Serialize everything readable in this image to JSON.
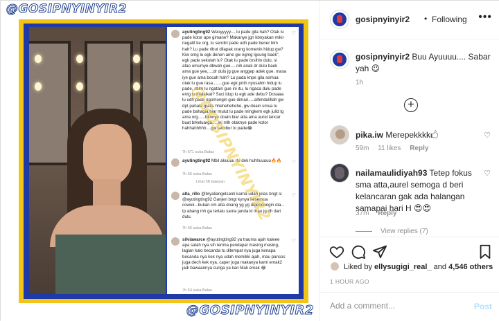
{
  "media": {
    "watermark": "@GOSIPNYINYIR2",
    "watermark_bottom": "@GOSIPNYINYIR2",
    "diagonal_watermark": "@GOSIPNYINYIR2",
    "screenshot_comments": [
      {
        "user": "ayutingting92",
        "text": "Weoyyyyy.....lu pade gila hah? Otak lu pade kotor ape gimane? Makanye jgn kbnyakan mikir negatif ke org, lu sendiri pade udh pade bener blm hah? Lu pade ribut dilapak orang komenin hidup gw? Kiw emg lu egk denen ame gw ngmg lgsung baek\", egk pade sekolah lu? Otak lu pade brsihin dulu, si atao umumye dbwah gue.....nih anak dr dulu baek ama gue yee,....dr dulu jg gue anggep adek gue, masa iye gue ama bocah hah? Lu pada knpe gila semua otak lu gue rasa........gue egk pnth nyusahin hidup lu pade, sblm lu ngatain gue ini itu, lu ngaca dulu pade emg lu malaikat? Suci idup lu egk ade debu? Dosaaa lu udh pade ngomongin gue dimari.....alhmdulillah gw dpt pahala gratis hhehehehehe, gw doain smua lu pade bahagia biar mulut lu pade mingkem egk julid lg ama org......bknnye doain biar atta ama aurel lancar buat brkeluarga,....ini mlh otaknye pade kotor hahhahhhhh....gw sembur lo pade😂",
        "meta": "7h   671 suka   Balas"
      },
      {
        "user": "ayutingting92",
        "text": "Mbil akuuuu itu dek huhhuuuuu🔥🔥",
        "meta": "7h   66 suka   Balas",
        "view": "Lihat 58 balasan"
      },
      {
        "user": "alta_rillo",
        "text": "@bryaliangelsanti karna udah jelas bngt si @ayutingting92 Ganjen bngt kynya kesemua cowok...bukan cm atta doang yg yg digendongin dia... tp abang mh ga terlalu sama janda kl mau jg dh dari dulu.",
        "meta": "7h   66 suka   Balas"
      },
      {
        "user": "silviawarce",
        "text": "@ayutingting92 ya trauma ajah kaleee apa salah nya sih terima pendapat masing masing, lagian kalo becanda tu ditempat nya juga kenapa becanda nya kek nya udah memiliki ajah, mau pansos juga dech kek nya, caper juga makanya kami emak2 jadi bawaannya curiga ya kan Mak emak 😂",
        "meta": "7h   53 suka   Balas"
      }
    ]
  },
  "header": {
    "username": "gosipnyinyir2",
    "separator": "•",
    "follow_status": "Following",
    "more_icon": "more-horizontal-icon"
  },
  "caption": {
    "username": "gosipnyinyir2",
    "text": "Buu Ayuuuu.... Sabar yah 😉",
    "time": "1h"
  },
  "load_more_icon": "plus-circle-icon",
  "comments": [
    {
      "username": "pika.iw",
      "text": "Merepekkkk🖒",
      "time": "59m",
      "likes": "11 likes",
      "reply": "Reply"
    },
    {
      "username": "nailamaulidiyah93",
      "text": "Tetep fokus sma atta,aurel semoga d beri kelancaran gak ada halangan samapai hari H 😍😍",
      "time": "37m",
      "reply": "Reply",
      "view_replies": "View replies (7)"
    }
  ],
  "actions": {
    "like_icon": "heart-icon",
    "comment_icon": "comment-icon",
    "share_icon": "send-icon",
    "save_icon": "bookmark-icon"
  },
  "likes": {
    "prefix": "Liked by",
    "user": "ellysugigi_real_",
    "joiner": "and",
    "others": "4,546 others"
  },
  "timestamp": "1 HOUR AGO",
  "add_comment": {
    "placeholder": "Add a comment...",
    "post_label": "Post"
  }
}
